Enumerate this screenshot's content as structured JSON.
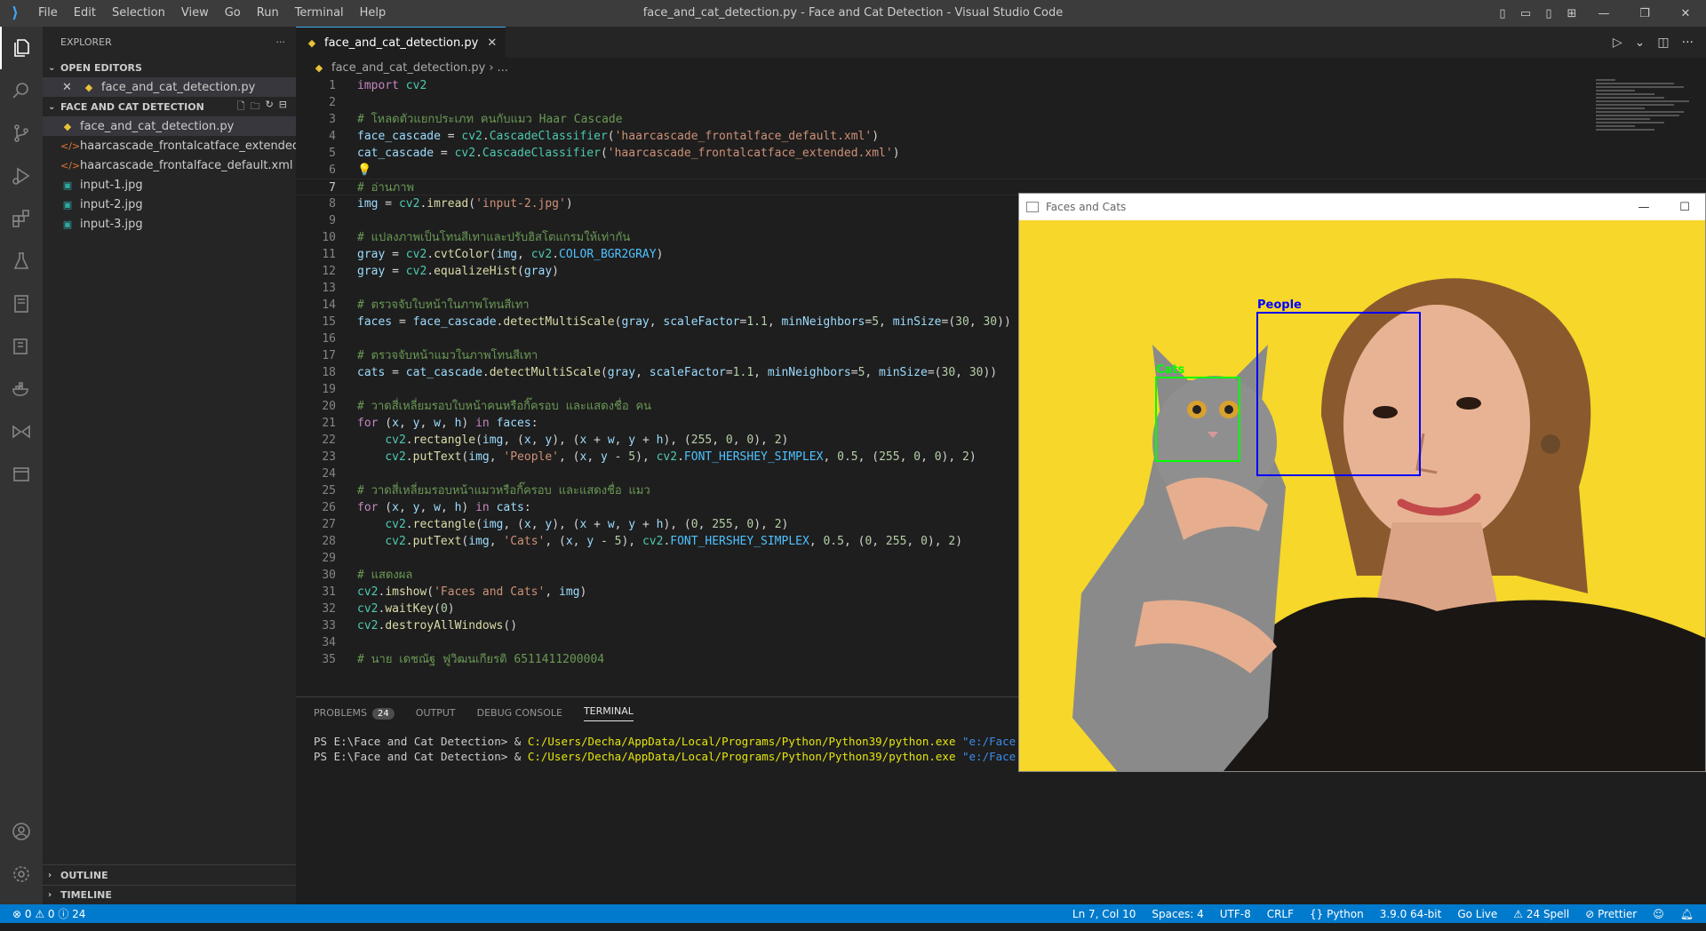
{
  "titlebar": {
    "menu": [
      "File",
      "Edit",
      "Selection",
      "View",
      "Go",
      "Run",
      "Terminal",
      "Help"
    ],
    "title": "face_and_cat_detection.py - Face and Cat Detection - Visual Studio Code"
  },
  "explorer": {
    "header": "EXPLORER",
    "open_editors_label": "OPEN EDITORS",
    "open_file": "face_and_cat_detection.py",
    "folder_label": "FACE AND CAT DETECTION",
    "files": [
      {
        "name": "face_and_cat_detection.py",
        "icon": "python-file-icon"
      },
      {
        "name": "haarcascade_frontalcatface_extended....",
        "icon": "xml-file-icon"
      },
      {
        "name": "haarcascade_frontalface_default.xml",
        "icon": "xml-file-icon"
      },
      {
        "name": "input-1.jpg",
        "icon": "image-file-icon"
      },
      {
        "name": "input-2.jpg",
        "icon": "image-file-icon"
      },
      {
        "name": "input-3.jpg",
        "icon": "image-file-icon"
      }
    ],
    "outline_label": "OUTLINE",
    "timeline_label": "TIMELINE"
  },
  "editor": {
    "tab_label": "face_and_cat_detection.py",
    "breadcrumb_file": "face_and_cat_detection.py",
    "breadcrumb_rest": "...",
    "line_numbers": [
      "1",
      "2",
      "3",
      "4",
      "5",
      "6",
      "7",
      "8",
      "9",
      "10",
      "11",
      "12",
      "13",
      "14",
      "15",
      "16",
      "17",
      "18",
      "19",
      "20",
      "21",
      "22",
      "23",
      "24",
      "25",
      "26",
      "27",
      "28",
      "29",
      "30",
      "31",
      "32",
      "33",
      "34",
      "35"
    ]
  },
  "panel": {
    "tabs": {
      "problems": "PROBLEMS",
      "problems_count": "24",
      "output": "OUTPUT",
      "debug": "DEBUG CONSOLE",
      "terminal": "TERMINAL"
    },
    "terminal_lines": [
      {
        "prompt": "PS E:\\Face and Cat Detection> & ",
        "exe": "C:/Users/Decha/AppData/Local/Programs/Python/Python39/python.exe",
        "arg": " \"e:/Face and Cat"
      },
      {
        "prompt": "PS E:\\Face and Cat Detection> & ",
        "exe": "C:/Users/Decha/AppData/Local/Programs/Python/Python39/python.exe",
        "arg": " \"e:/Face and Cat"
      }
    ]
  },
  "statusbar": {
    "left": "⊗ 0 ⚠ 0 ⓘ 24",
    "right": [
      "Ln 7, Col 10",
      "Spaces: 4",
      "UTF-8",
      "CRLF",
      "{} Python",
      "3.9.0 64-bit",
      "Go Live",
      "⚠ 24 Spell",
      "⊘ Prettier"
    ]
  },
  "cv_window": {
    "title": "Faces and Cats",
    "people_label": "People",
    "cats_label": "Cats"
  }
}
